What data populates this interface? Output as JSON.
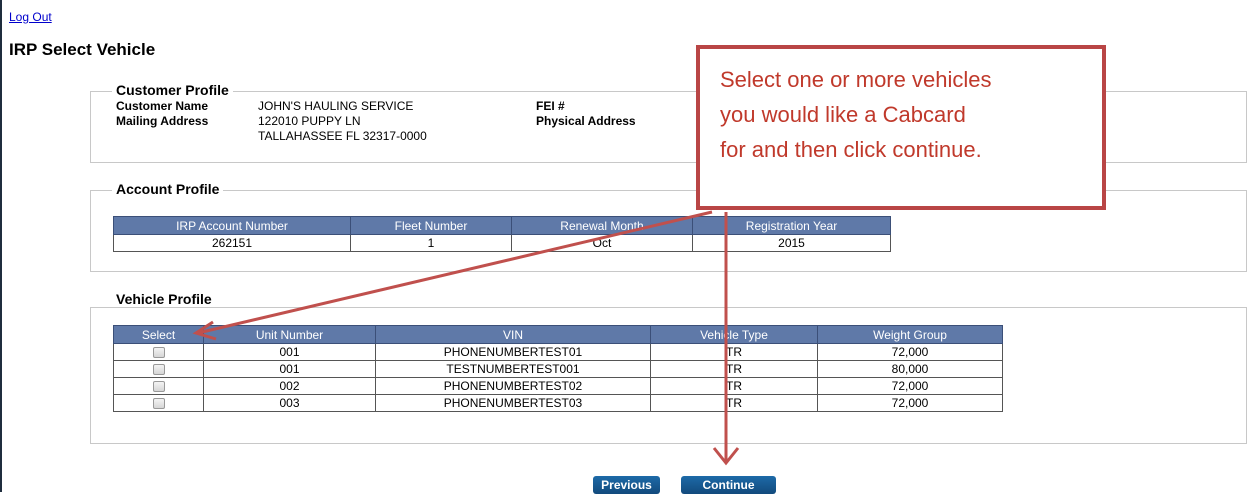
{
  "header": {
    "logout": "Log Out",
    "title": "IRP Select Vehicle"
  },
  "customer_profile": {
    "legend": "Customer Profile",
    "name_label": "Customer Name",
    "name_value": "JOHN'S HAULING SERVICE",
    "mailing_label": "Mailing Address",
    "mailing_line1": "122010 PUPPY LN",
    "mailing_line2": "TALLAHASSEE FL 32317-0000",
    "fei_label": "FEI #",
    "physical_label": "Physical Address"
  },
  "account_profile": {
    "legend": "Account Profile",
    "headers": [
      "IRP Account Number",
      "Fleet Number",
      "Renewal Month",
      "Registration Year"
    ],
    "row": [
      "262151",
      "1",
      "Oct",
      "2015"
    ]
  },
  "vehicle_profile": {
    "legend": "Vehicle Profile",
    "headers": [
      "Select",
      "Unit Number",
      "VIN",
      "Vehicle Type",
      "Weight Group"
    ],
    "rows": [
      [
        "001",
        "PHONENUMBERTEST01",
        "TR",
        "72,000"
      ],
      [
        "001",
        "TESTNUMBERTEST001",
        "TR",
        "80,000"
      ],
      [
        "002",
        "PHONENUMBERTEST02",
        "TR",
        "72,000"
      ],
      [
        "003",
        "PHONENUMBERTEST03",
        "TR",
        "72,000"
      ]
    ]
  },
  "buttons": {
    "previous": "Previous",
    "continue": "Continue"
  },
  "callout": {
    "lines": [
      "Select one or more vehicles",
      "you would like a Cabcard",
      "for and then click continue."
    ],
    "color": "#c0392b"
  }
}
